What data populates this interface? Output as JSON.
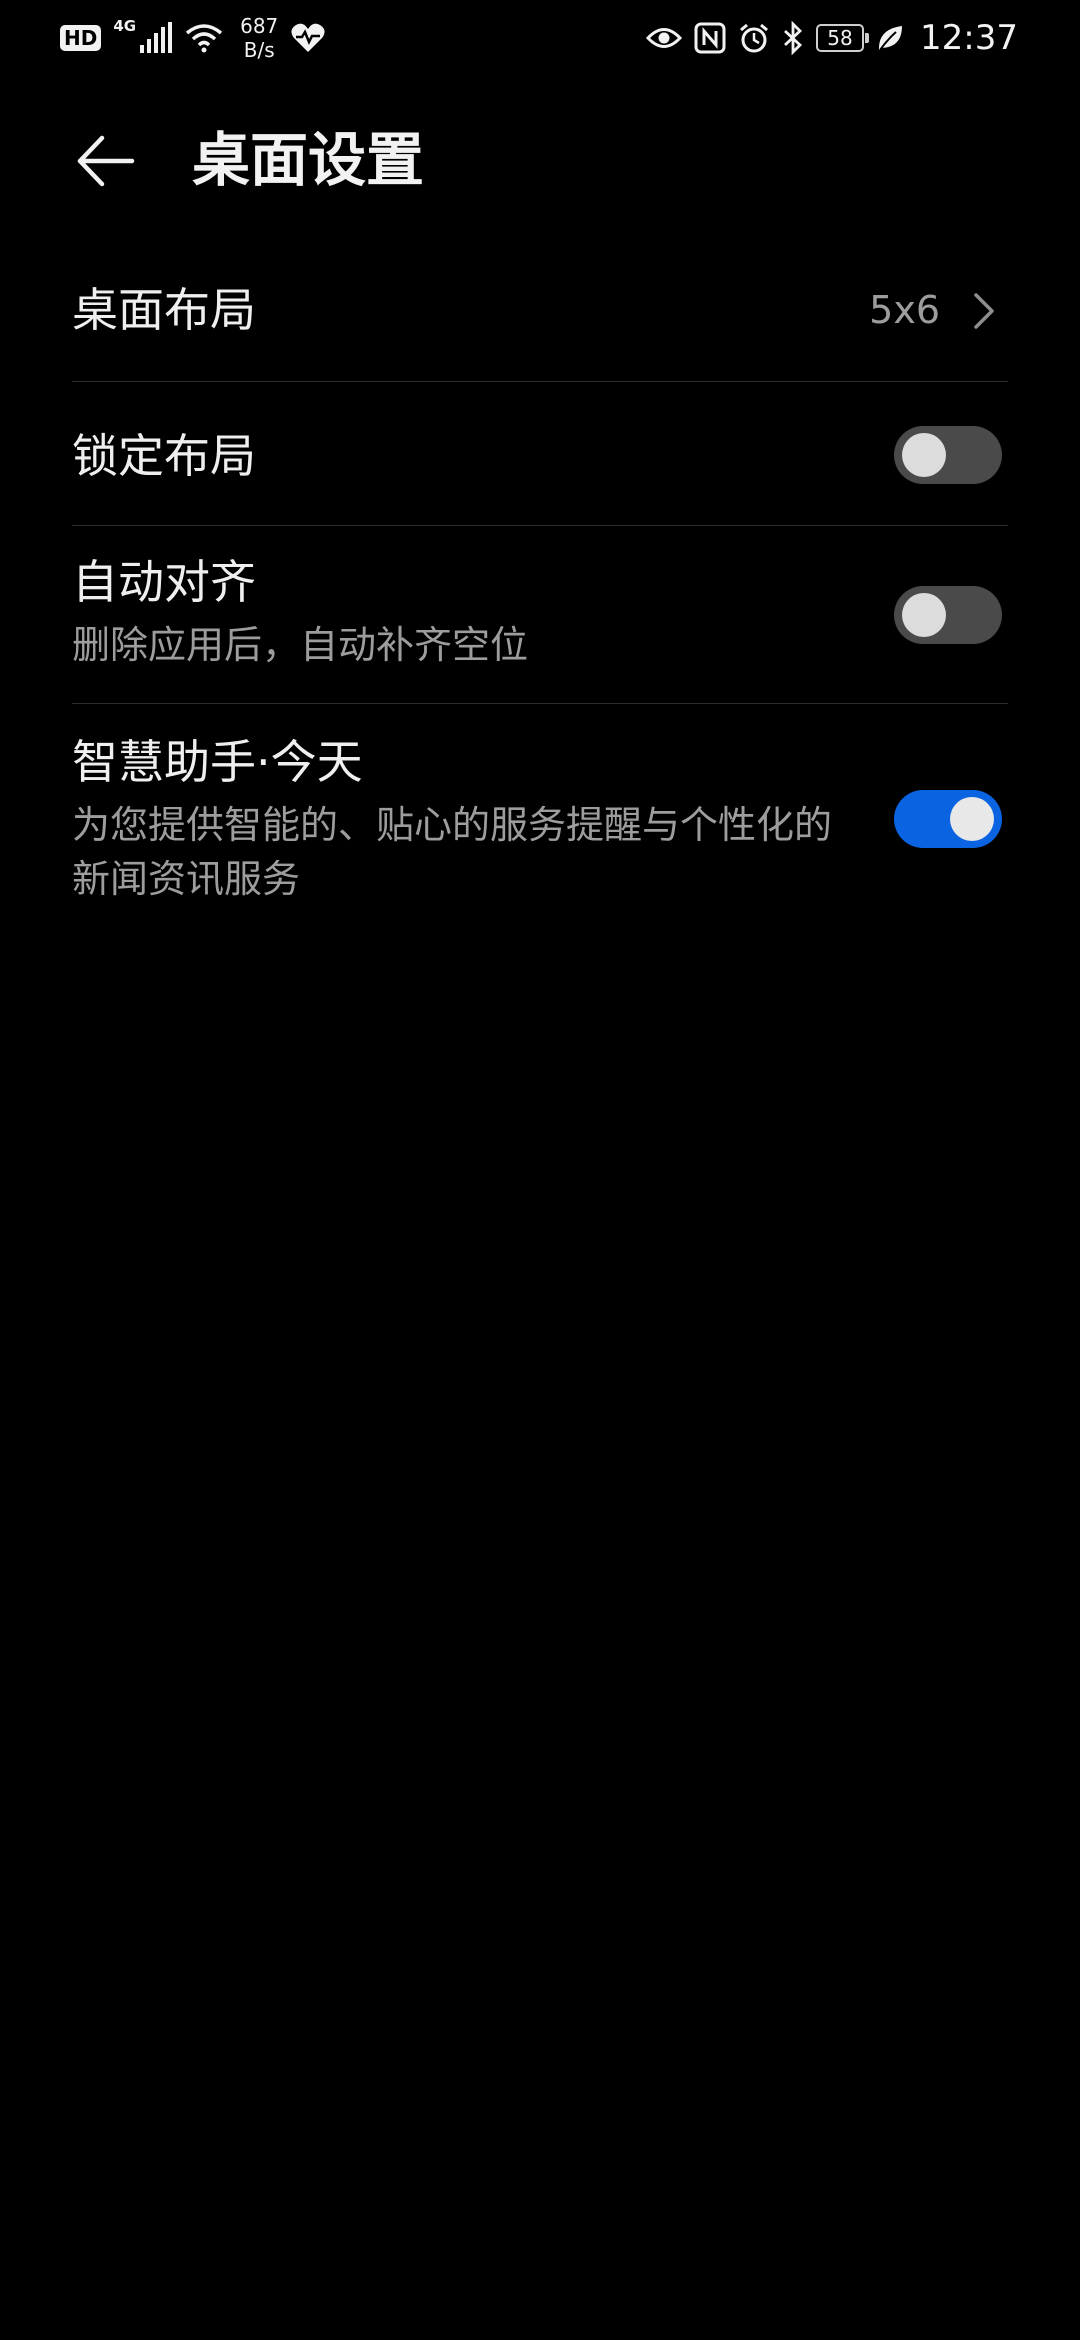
{
  "status_bar": {
    "hd_badge": "HD",
    "network_type": "4G",
    "speed_value": "687",
    "speed_unit": "B/s",
    "battery_level": "58",
    "time": "12:37",
    "icons": [
      "hd-icon",
      "signal-icon",
      "wifi-icon",
      "heart-rate-icon",
      "eye-icon",
      "nfc-icon",
      "alarm-icon",
      "bluetooth-icon",
      "battery-icon",
      "leaf-icon"
    ]
  },
  "header": {
    "title": "桌面设置"
  },
  "settings": {
    "items": [
      {
        "title": "桌面布局",
        "value": "5x6",
        "control": "chevron"
      },
      {
        "title": "锁定布局",
        "control": "toggle",
        "checked": false
      },
      {
        "title": "自动对齐",
        "subtitle": "删除应用后，自动补齐空位",
        "control": "toggle",
        "checked": false
      },
      {
        "title": "智慧助手·今天",
        "subtitle": "为您提供智能的、贴心的服务提醒与个性化的新闻资讯服务",
        "control": "toggle",
        "checked": true
      }
    ]
  },
  "colors": {
    "background": "#000000",
    "toggle_on": "#0a63e0",
    "toggle_off": "#4a4a4a",
    "primary_text": "#efefef",
    "secondary_text": "#9d9d9d"
  }
}
